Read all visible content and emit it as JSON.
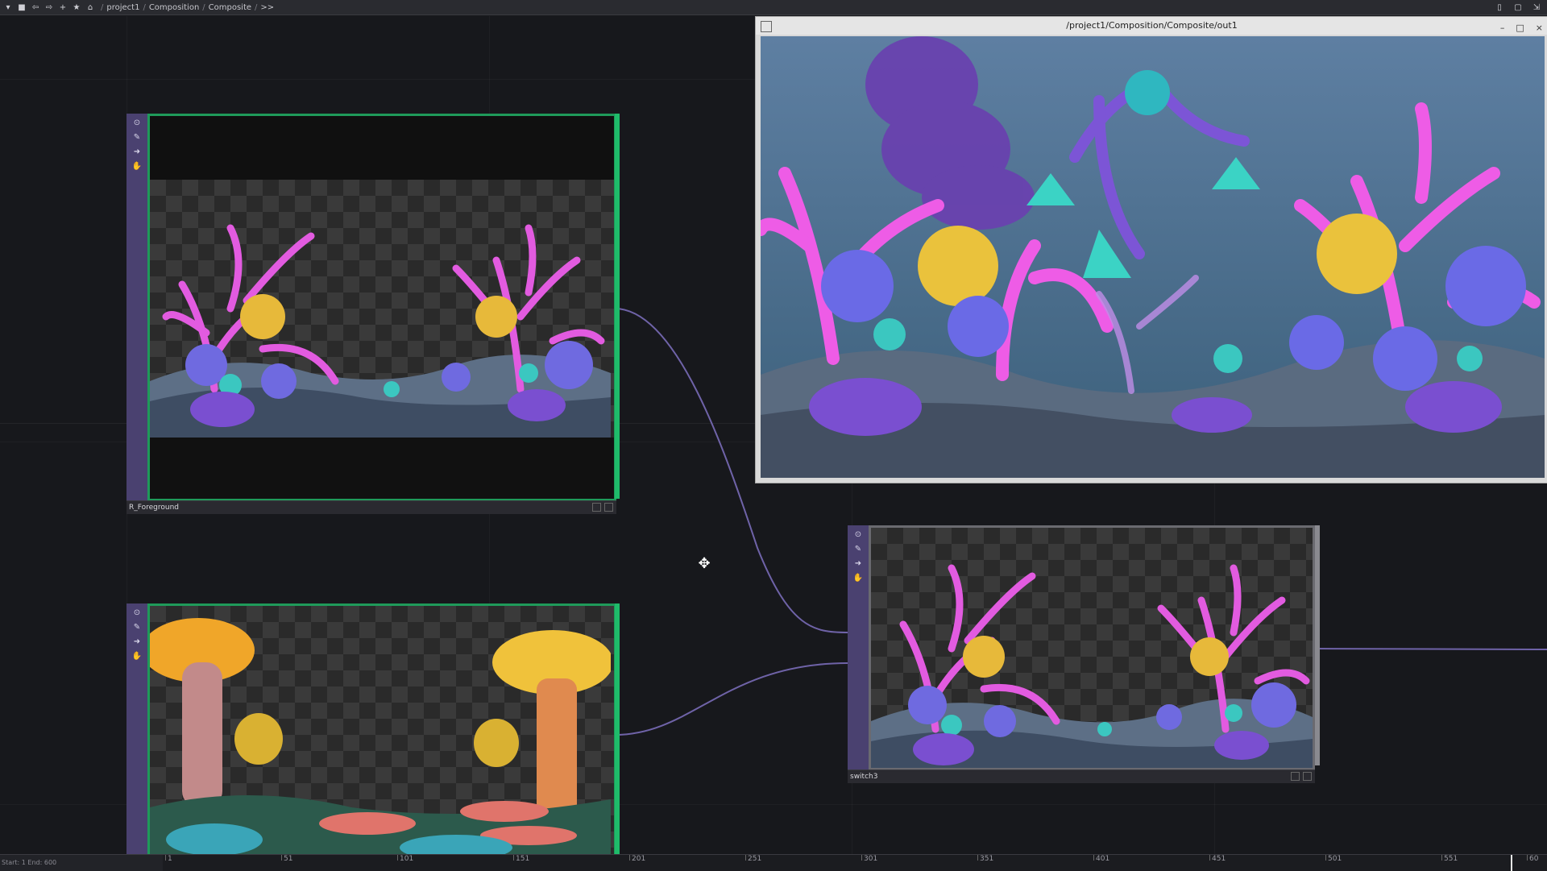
{
  "topbar": {
    "breadcrumb": [
      "project1",
      "Composition",
      "Composite",
      ">>"
    ],
    "separator": "/"
  },
  "preview_window": {
    "title": "/project1/Composition/Composite/out1",
    "controls": [
      "–",
      "□",
      "×"
    ]
  },
  "nodes": {
    "foreground": {
      "label": "R_Foreground"
    },
    "mushrooms": {
      "label": ""
    },
    "switch": {
      "label": "switch3"
    }
  },
  "timeline": {
    "left_text": "Start: 1    End: 600",
    "ticks": [
      "1",
      "51",
      "101",
      "151",
      "201",
      "251",
      "301",
      "351",
      "401",
      "451",
      "501",
      "551",
      "60"
    ]
  },
  "colors": {
    "accent": "#1f9a5a",
    "node_strip": "#4a4170",
    "wire": "#6f63a8"
  }
}
